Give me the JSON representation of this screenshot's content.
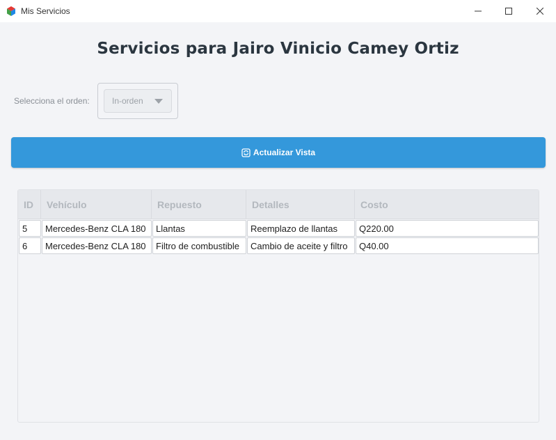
{
  "window": {
    "title": "Mis Servicios",
    "minimize_glyph": "—",
    "maximize_glyph": "☐",
    "close_glyph": "✕"
  },
  "header": {
    "title": "Servicios para Jairo Vinicio Camey Ortiz"
  },
  "order": {
    "label": "Selecciona el orden:",
    "selected": "In-orden"
  },
  "refresh_button": {
    "label": "Actualizar Vista",
    "icon": "refresh-icon",
    "color": "#3498db"
  },
  "table": {
    "columns": [
      "ID",
      "Vehículo",
      "Repuesto",
      "Detalles",
      "Costo"
    ],
    "rows": [
      {
        "id": "5",
        "vehiculo": "Mercedes-Benz CLA 180",
        "repuesto": "Llantas",
        "detalles": "Reemplazo de llantas",
        "costo": "Q220.00"
      },
      {
        "id": "6",
        "vehiculo": "Mercedes-Benz CLA 180",
        "repuesto": "Filtro de combustible",
        "detalles": "Cambio de aceite y filtro",
        "costo": "Q40.00"
      }
    ]
  }
}
